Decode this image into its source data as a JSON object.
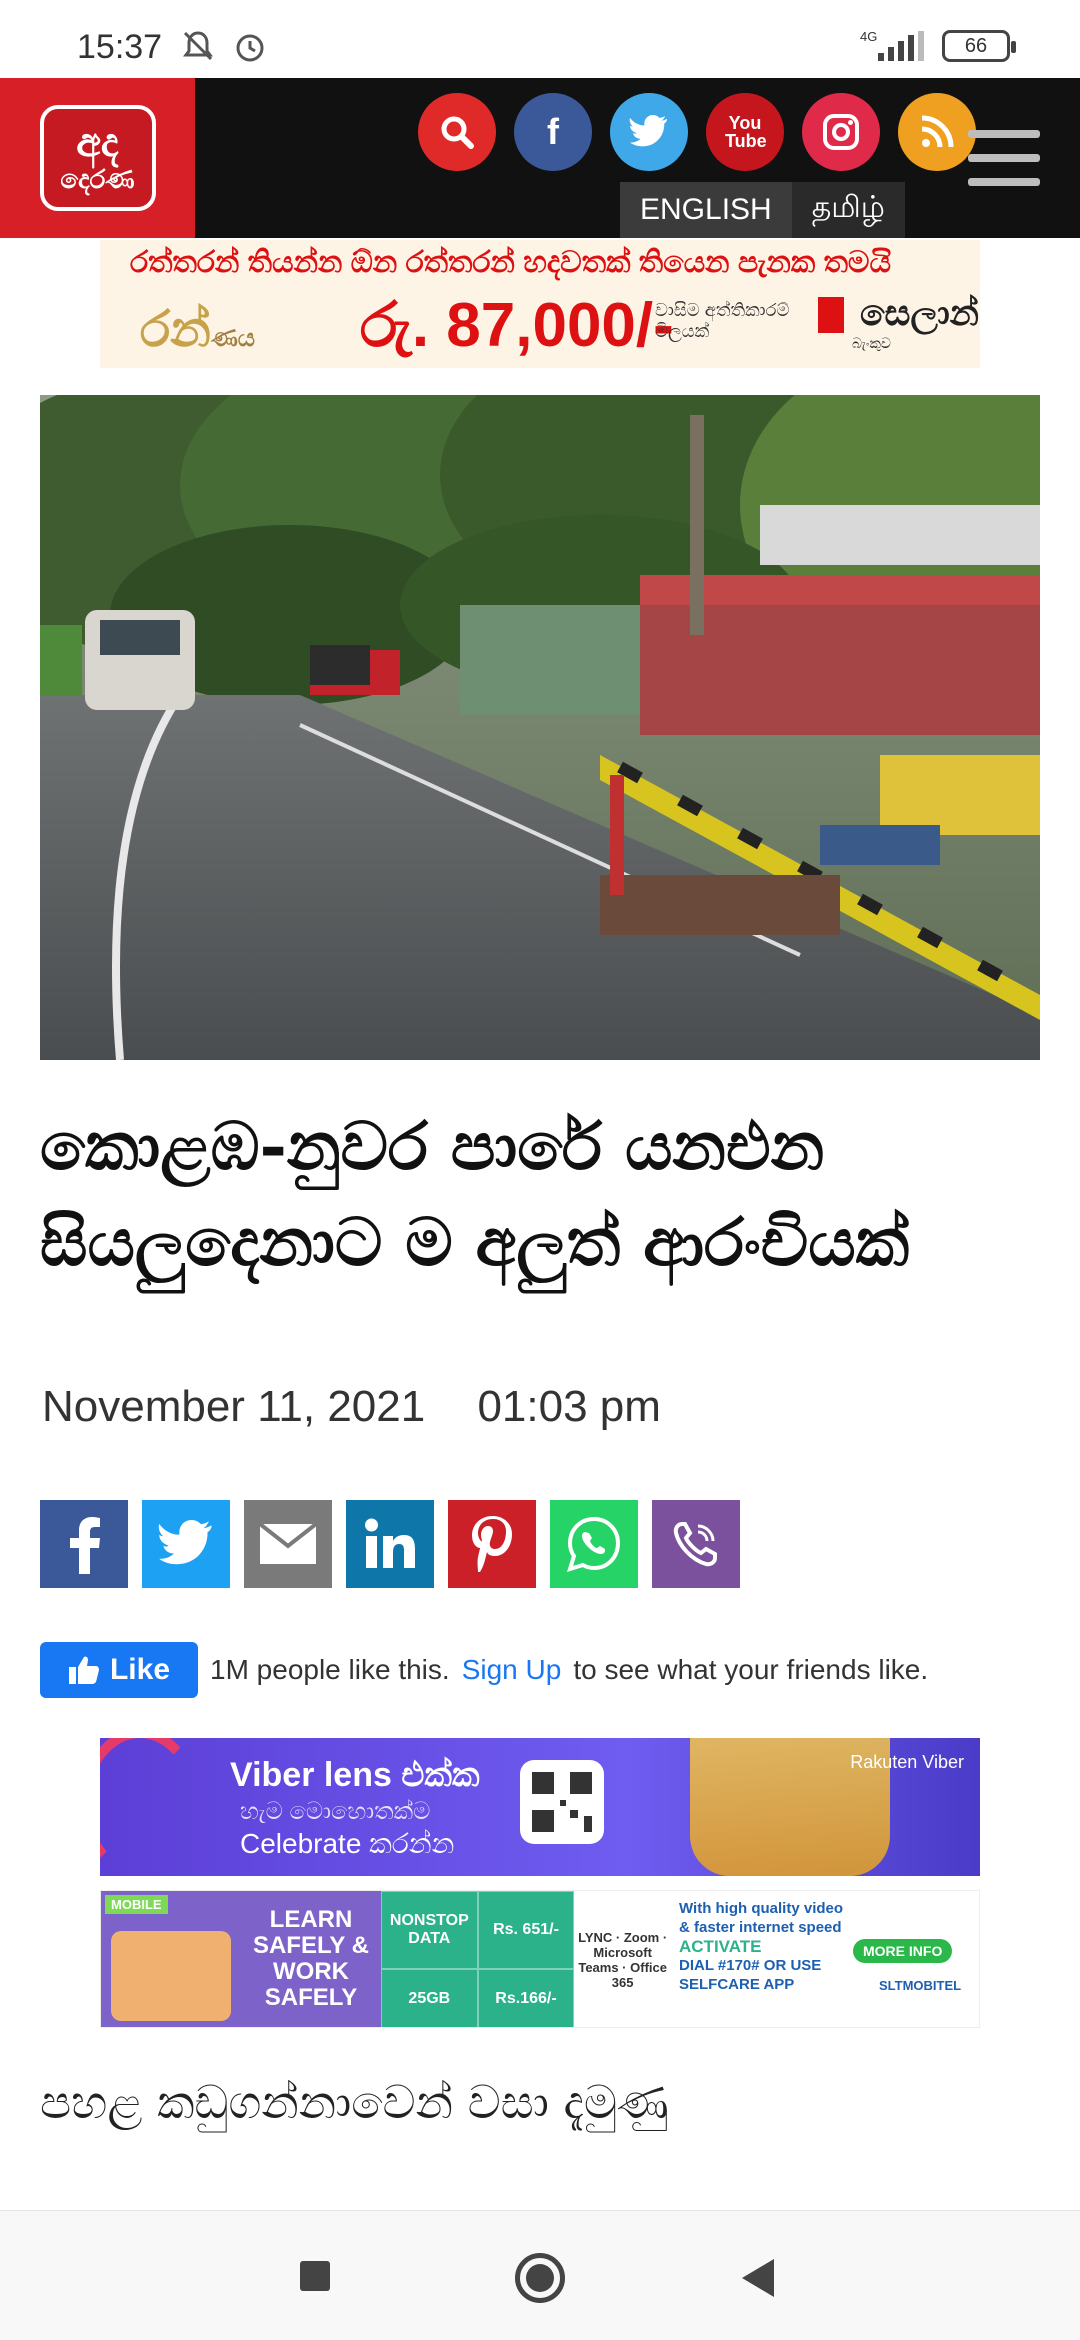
{
  "status_bar": {
    "time": "15:37",
    "network": "4G",
    "battery": "66"
  },
  "header": {
    "logo_top": "අද",
    "logo_bottom": "දෙරණ",
    "social": [
      {
        "name": "search",
        "color": "#e02a2a"
      },
      {
        "name": "facebook",
        "color": "#3b5998",
        "glyph": "f"
      },
      {
        "name": "twitter",
        "color": "#3ea8e8"
      },
      {
        "name": "youtube",
        "color": "#c4161c",
        "glyph": "You Tube"
      },
      {
        "name": "instagram",
        "color": "#e02a4a"
      },
      {
        "name": "rss",
        "color": "#f0a020"
      }
    ],
    "lang_english": "ENGLISH",
    "lang_tamil": "தமிழ்"
  },
  "ad_top": {
    "line1": "රත්තරන් තියන්න ඕන රත්තරන් හදවතක් තියෙන පැනක තමයි",
    "logo": "රන්",
    "logo_suffix": "ණය",
    "price": "රු. 87,000/-",
    "mid_text": "වාසිම අත්තිකාරම් මිලයක්",
    "brand": "සෙලාන්",
    "brand_sub": "බැංකුව"
  },
  "article": {
    "title": "කොළඹ-නුවර පාරේ යනඑන සියලුදෙනාට ම අලුත් ආරංචියක්",
    "date": "November 11, 2021",
    "time": "01:03 pm",
    "body_start": "පහළ කඩුගන්නාවෙන් වසා දැමුණු"
  },
  "share": [
    {
      "name": "facebook",
      "color": "#3b5998"
    },
    {
      "name": "twitter",
      "color": "#1da1f2"
    },
    {
      "name": "email",
      "color": "#7a7a7a"
    },
    {
      "name": "linkedin",
      "color": "#0e76a8"
    },
    {
      "name": "pinterest",
      "color": "#cb2027"
    },
    {
      "name": "whatsapp",
      "color": "#25d366"
    },
    {
      "name": "viber",
      "color": "#7b519d"
    }
  ],
  "fb_like": {
    "button": "Like",
    "text_before": "1M people like this.",
    "link": "Sign Up",
    "text_after": "to see what your friends like."
  },
  "ad_viber": {
    "line1": "Viber lens එක්ක",
    "line2": "හැම මොහොතක්ම",
    "line3": "Celebrate කරන්න",
    "brand": "Rakuten Viber"
  },
  "ad_slt": {
    "tag": "MOBILE",
    "learn": "LEARN SAFELY & WORK SAFELY",
    "cell1": "NONSTOP DATA",
    "cell2": "Rs. 651/-",
    "cell3": "25GB",
    "cell4": "Rs.166/-",
    "apps": "LYNC · Zoom · Microsoft Teams · Office 365",
    "right1": "With high quality video & faster internet speed",
    "activate": "ACTIVATE",
    "right2": "DIAL #170# OR USE SELFCARE APP",
    "more": "MORE INFO",
    "brand": "SLTMOBITEL"
  }
}
